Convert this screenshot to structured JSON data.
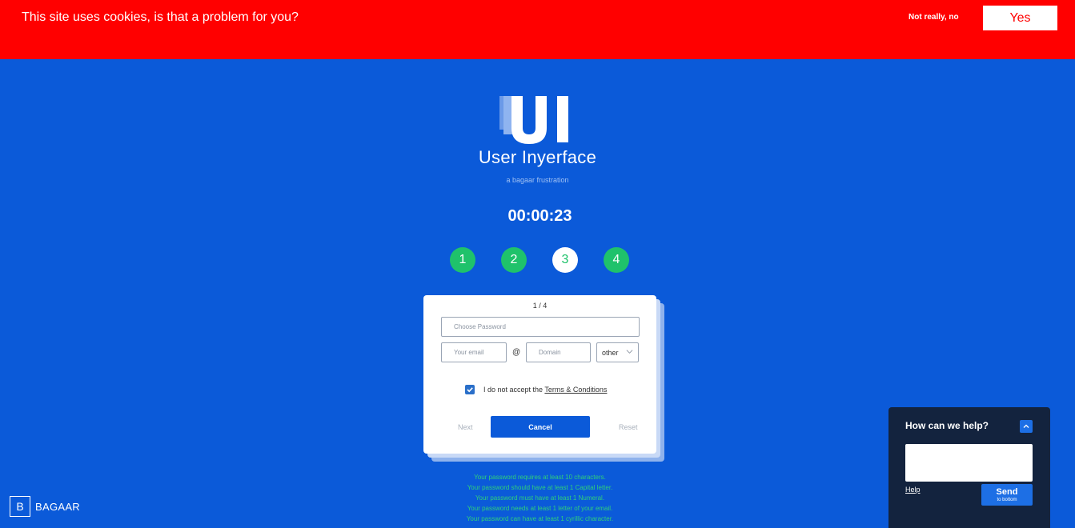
{
  "cookie_banner": {
    "message": "This site uses cookies, is that a problem for you?",
    "decline_label": "Not really, no",
    "accept_label": "Yes"
  },
  "header": {
    "logo_text": "UI",
    "title": "User Inyerface",
    "subtitle": "a bagaar frustration",
    "timer": "00:00:23"
  },
  "steps": [
    {
      "label": "1",
      "active": false
    },
    {
      "label": "2",
      "active": false
    },
    {
      "label": "3",
      "active": true
    },
    {
      "label": "4",
      "active": false
    }
  ],
  "form": {
    "page_counter": "1 / 4",
    "password_placeholder": "Choose Password",
    "email_placeholder": "Your email",
    "at_symbol": "@",
    "domain_placeholder": "Domain",
    "tld_value": "other",
    "terms_checked": true,
    "terms_text": "I do not accept the",
    "terms_link": "Terms & Conditions",
    "next_label": "Next",
    "cancel_label": "Cancel",
    "reset_label": "Reset"
  },
  "password_hints": [
    "Your password requires at least 10 characters.",
    "Your password should have at least 1 Capital letter.",
    "Your password must have at least 1 Numeral.",
    "Your password needs at least 1 letter of your email.",
    "Your password can have at least 1 cyrillic character."
  ],
  "footer": {
    "brand_letter": "B",
    "brand_name": "BAGAAR"
  },
  "help_widget": {
    "title": "How can we help?",
    "help_link": "Help",
    "send_label": "Send",
    "send_sublabel": "to bottom"
  },
  "colors": {
    "background": "#0b5ad9",
    "cookie_banner": "#ff0000",
    "step_done": "#1fc26b",
    "hint_text": "#2fd07a",
    "help_panel": "#13233e"
  }
}
